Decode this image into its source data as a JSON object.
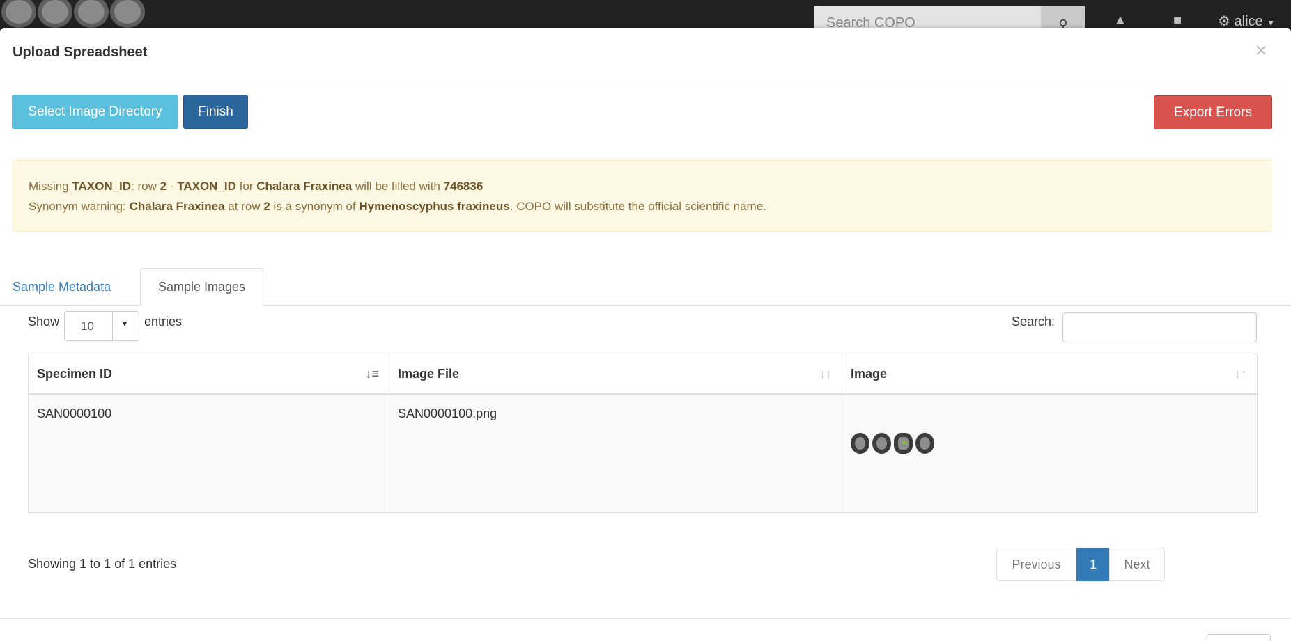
{
  "navbar": {
    "search_placeholder": "Search COPO",
    "user_label": "alice"
  },
  "modal": {
    "title": "Upload Spreadsheet",
    "close_label": "×"
  },
  "toolbar": {
    "select_dir_label": "Select Image Directory",
    "finish_label": "Finish",
    "export_errors_label": "Export Errors"
  },
  "alert": {
    "line1": {
      "p1": "Missing ",
      "field": "TAXON_ID",
      "p2": ": row ",
      "row": "2",
      "p3": " - ",
      "field2": "TAXON_ID",
      "p4": " for ",
      "species": "Chalara Fraxinea",
      "p5": " will be filled with ",
      "taxon": "746836"
    },
    "line2": {
      "p1": "Synonym warning: ",
      "species": "Chalara Fraxinea",
      "p2": " at row ",
      "row": "2",
      "p3": " is a synonym of ",
      "official": "Hymenoscyphus fraxineus",
      "p4": ". COPO will substitute the official scientific name."
    }
  },
  "tabs": {
    "metadata": "Sample Metadata",
    "images": "Sample Images"
  },
  "datatable": {
    "show_label": "Show",
    "length_value": "10",
    "entries_label": "entries",
    "search_label": "Search:",
    "columns": [
      "Specimen ID",
      "Image File",
      "Image"
    ],
    "rows": [
      {
        "specimen_id": "SAN0000100",
        "image_file": "SAN0000100.png"
      }
    ],
    "info": "Showing 1 to 1 of 1 entries",
    "pagination": {
      "previous": "Previous",
      "current": "1",
      "next": "Next"
    }
  },
  "colors": {
    "info_button": "#5bc0de",
    "primary_button": "#2b679c",
    "danger_button": "#d9534f",
    "warning_bg": "#fcf8e3",
    "link": "#337ab7"
  }
}
